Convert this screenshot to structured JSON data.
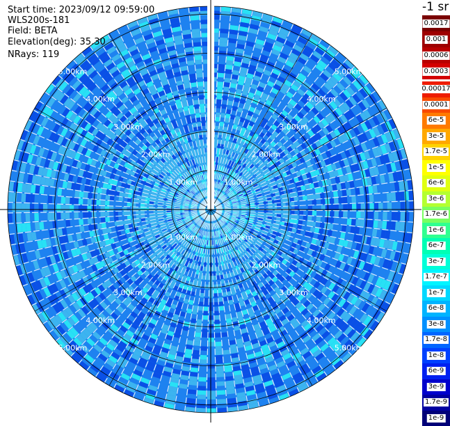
{
  "header": {
    "start_time": "Start time: 2023/09/12 09:59:00",
    "instrument": "WLS200s-181",
    "field": "Field: BETA",
    "elevation": "Elevation(deg): 35.30",
    "nrays": "NRays: 119"
  },
  "units_label": "-1 sr",
  "range_rings": [
    "1.00km",
    "2.00km",
    "3.00km",
    "4.00km",
    "5.00km"
  ],
  "max_range_km": 5.2,
  "ray_count": 119,
  "colorbar": {
    "high_range": [
      {
        "label": "0.0017",
        "color": "#7a0000"
      },
      {
        "label": "0.001",
        "color": "#9e0000"
      },
      {
        "label": "0.0006",
        "color": "#b80000"
      },
      {
        "label": "0.0003",
        "color": "#d40000"
      }
    ],
    "main_range": [
      {
        "label": "0.00017",
        "color": "#ee1c00"
      },
      {
        "label": "0.0001",
        "color": "#f84a00"
      },
      {
        "label": "6e-5",
        "color": "#ff7a00"
      },
      {
        "label": "3e-5",
        "color": "#ffa800"
      },
      {
        "label": "1.7e-5",
        "color": "#ffd200"
      },
      {
        "label": "1e-5",
        "color": "#ffff00"
      },
      {
        "label": "6e-6",
        "color": "#e0ff10"
      },
      {
        "label": "3e-6",
        "color": "#b4ff30"
      },
      {
        "label": "1.7e-6",
        "color": "#78ff60"
      },
      {
        "label": "1e-6",
        "color": "#30ff90"
      },
      {
        "label": "6e-7",
        "color": "#00ffb4"
      },
      {
        "label": "3e-7",
        "color": "#00ffd8"
      },
      {
        "label": "1.7e-7",
        "color": "#00f4ff"
      },
      {
        "label": "1e-7",
        "color": "#00d8ff"
      },
      {
        "label": "6e-8",
        "color": "#00b4ff"
      },
      {
        "label": "3e-8",
        "color": "#0090ff"
      },
      {
        "label": "1.7e-8",
        "color": "#0066ff"
      },
      {
        "label": "1e-8",
        "color": "#0040ff"
      },
      {
        "label": "6e-9",
        "color": "#0020f0"
      },
      {
        "label": "3e-9",
        "color": "#0000cc"
      },
      {
        "label": "1.7e-9",
        "color": "#0000a0"
      },
      {
        "label": "1e-9",
        "color": "#000078"
      }
    ]
  },
  "colors": {
    "background_blue": "#1e82f0",
    "dark_blue": "#0a50e6",
    "light_blue": "#3cb4f0",
    "cyan": "#28e1f5",
    "ring_color": "#000000",
    "ring_label_color": "#ffffff"
  }
}
